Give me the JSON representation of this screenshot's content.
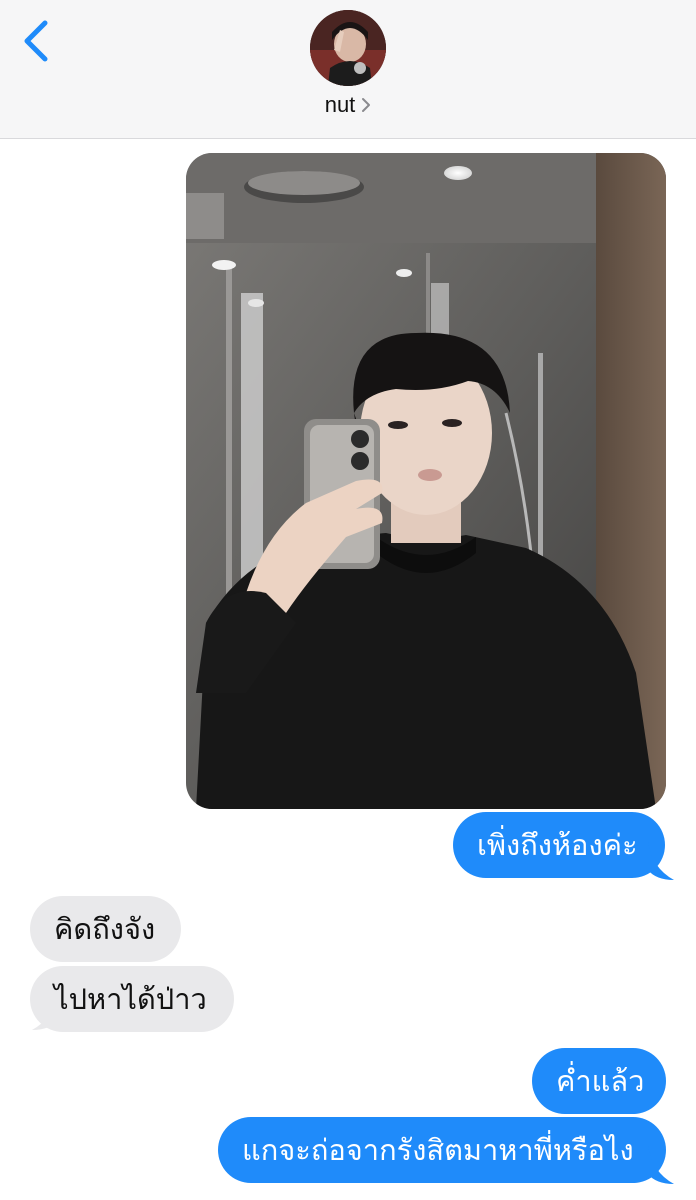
{
  "header": {
    "contact_name": "nut",
    "accent_color": "#1f8bfa",
    "back_icon": "chevron-left-icon",
    "disclosure_icon": "chevron-right-icon"
  },
  "messages": [
    {
      "id": "photo",
      "sender": "me",
      "type": "image",
      "subject": "mirror-selfie"
    },
    {
      "id": "m1",
      "sender": "me",
      "type": "text",
      "text": "เพิ่งถึงห้องค่ะ"
    },
    {
      "id": "m2",
      "sender": "them",
      "type": "text",
      "text": "คิดถึงจัง"
    },
    {
      "id": "m3",
      "sender": "them",
      "type": "text",
      "text": "ไปหาได้ป่าว"
    },
    {
      "id": "m4",
      "sender": "me",
      "type": "text",
      "text": "ค่ำแล้ว"
    },
    {
      "id": "m5",
      "sender": "me",
      "type": "text",
      "text": "แกจะถ่อจากรังสิตมาหาพี่หรือไง"
    }
  ],
  "colors": {
    "sent_bubble": "#1f8bfa",
    "received_bubble": "#e9e9eb",
    "header_bg": "#f6f6f7"
  }
}
